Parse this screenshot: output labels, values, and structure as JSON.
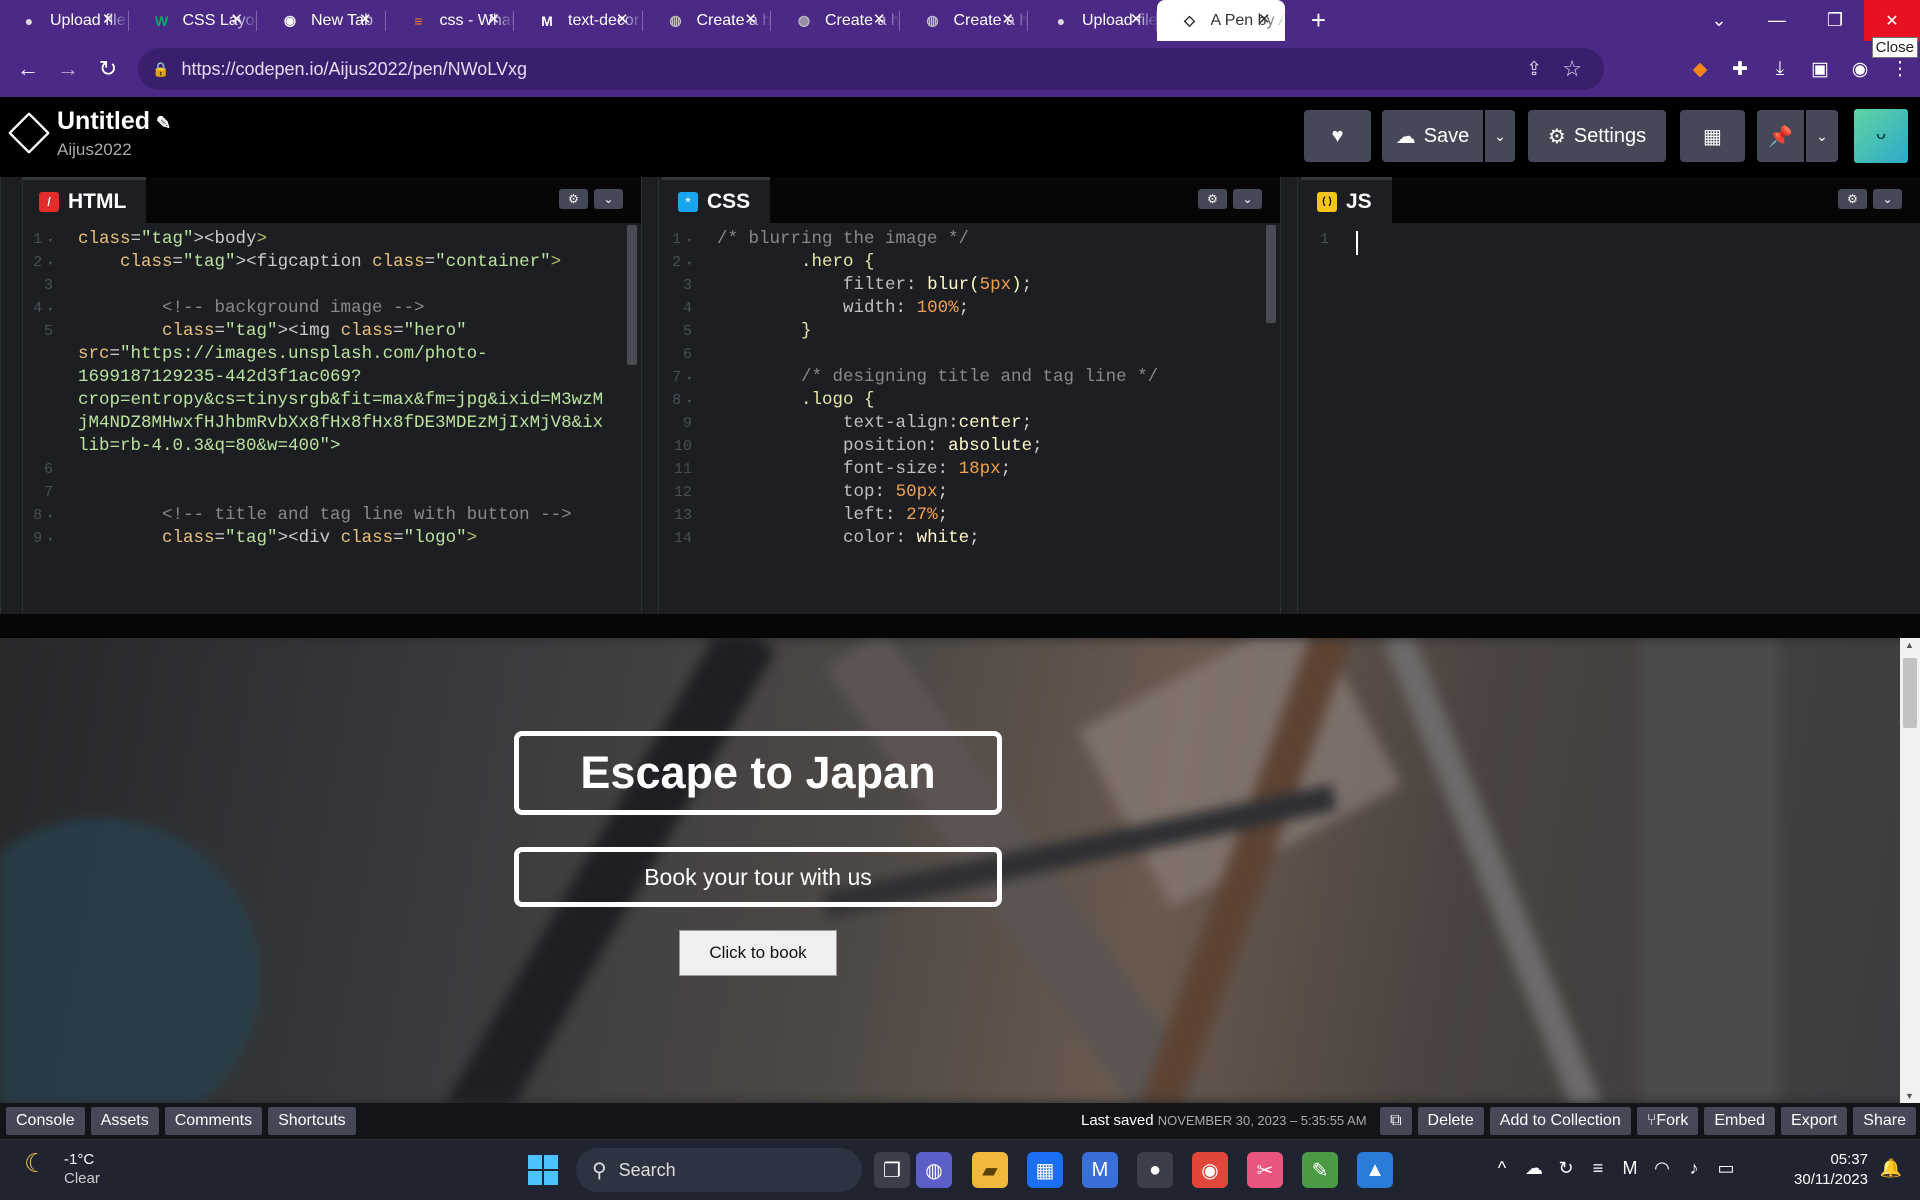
{
  "browser": {
    "tabs": [
      {
        "title": "Upload file",
        "favicon": "github-icon",
        "active": false
      },
      {
        "title": "CSS Layout",
        "favicon": "w3schools-icon",
        "active": false
      },
      {
        "title": "New Tab",
        "favicon": "chrome-icon",
        "active": false
      },
      {
        "title": "css - What",
        "favicon": "stackoverflow-icon",
        "active": false
      },
      {
        "title": "text-decor",
        "favicon": "mdn-icon",
        "active": false
      },
      {
        "title": "Create a he",
        "favicon": "globe-icon",
        "active": false
      },
      {
        "title": "Create a he",
        "favicon": "globe-icon",
        "active": false
      },
      {
        "title": "Create a he",
        "favicon": "globe-icon",
        "active": false
      },
      {
        "title": "Upload file",
        "favicon": "github-icon",
        "active": false
      },
      {
        "title": "A Pen by A",
        "favicon": "codepen-icon",
        "active": true
      }
    ],
    "close_tooltip": "Close",
    "url": "https://codepen.io/Aijus2022/pen/NWoLVxg"
  },
  "codepen": {
    "pen_title": "Untitled",
    "username": "Aijus2022",
    "save_label": "Save",
    "settings_label": "Settings",
    "panels": {
      "html": {
        "label": "HTML",
        "color": "#e42c2c"
      },
      "css": {
        "label": "CSS",
        "color": "#1aa6ef"
      },
      "js": {
        "label": "JS",
        "color": "#f5c518"
      }
    },
    "html_code": [
      {
        "n": "1",
        "fold": true,
        "text": "<body>"
      },
      {
        "n": "2",
        "fold": true,
        "text": "    <figcaption class=\"container\">"
      },
      {
        "n": "3",
        "fold": false,
        "text": ""
      },
      {
        "n": "4",
        "fold": true,
        "text": "        <!-- background image -->"
      },
      {
        "n": "5",
        "fold": false,
        "text": "        <img class=\"hero\""
      },
      {
        "n": "",
        "fold": false,
        "text": "src=\"https://images.unsplash.com/photo-"
      },
      {
        "n": "",
        "fold": false,
        "text": "1699187129235-442d3f1ac069?"
      },
      {
        "n": "",
        "fold": false,
        "text": "crop=entropy&cs=tinysrgb&fit=max&fm=jpg&ixid=M3wzM"
      },
      {
        "n": "",
        "fold": false,
        "text": "jM4NDZ8MHwxfHJhbmRvbXx8fHx8fHx8fDE3MDEzMjIxMjV8&ix"
      },
      {
        "n": "",
        "fold": false,
        "text": "lib=rb-4.0.3&q=80&w=400\">"
      },
      {
        "n": "6",
        "fold": false,
        "text": ""
      },
      {
        "n": "7",
        "fold": false,
        "text": ""
      },
      {
        "n": "8",
        "fold": true,
        "text": "        <!-- title and tag line with button -->"
      },
      {
        "n": "9",
        "fold": true,
        "text": "        <div class=\"logo\">"
      }
    ],
    "css_code": [
      {
        "n": "1",
        "fold": true,
        "text": "/* blurring the image */"
      },
      {
        "n": "2",
        "fold": true,
        "text": "        .hero {"
      },
      {
        "n": "3",
        "fold": false,
        "text": "            filter: blur(5px);"
      },
      {
        "n": "4",
        "fold": false,
        "text": "            width: 100%;"
      },
      {
        "n": "5",
        "fold": false,
        "text": "        }"
      },
      {
        "n": "6",
        "fold": false,
        "text": ""
      },
      {
        "n": "7",
        "fold": true,
        "text": "        /* designing title and tag line */"
      },
      {
        "n": "8",
        "fold": true,
        "text": "        .logo {"
      },
      {
        "n": "9",
        "fold": false,
        "text": "            text-align:center;"
      },
      {
        "n": "10",
        "fold": false,
        "text": "            position: absolute;"
      },
      {
        "n": "11",
        "fold": false,
        "text": "            font-size: 18px;"
      },
      {
        "n": "12",
        "fold": false,
        "text": "            top: 50px;"
      },
      {
        "n": "13",
        "fold": false,
        "text": "            left: 27%;"
      },
      {
        "n": "14",
        "fold": false,
        "text": "            color: white;"
      }
    ],
    "js_code": [
      {
        "n": "1",
        "text": ""
      }
    ],
    "preview": {
      "title": "Escape to Japan",
      "tagline": "Book your tour with us",
      "button": "Click to book"
    },
    "bottom": {
      "left_buttons": [
        "Console",
        "Assets",
        "Comments",
        "Shortcuts"
      ],
      "last_saved_label": "Last saved",
      "last_saved_date": "NOVEMBER 30, 2023 – 5:35:55 AM",
      "right_buttons": [
        "Delete",
        "Add to Collection",
        "Fork",
        "Embed",
        "Export",
        "Share"
      ]
    }
  },
  "taskbar": {
    "weather_temp": "-1°C",
    "weather_desc": "Clear",
    "search_placeholder": "Search",
    "time": "05:37",
    "date": "30/11/2023"
  }
}
